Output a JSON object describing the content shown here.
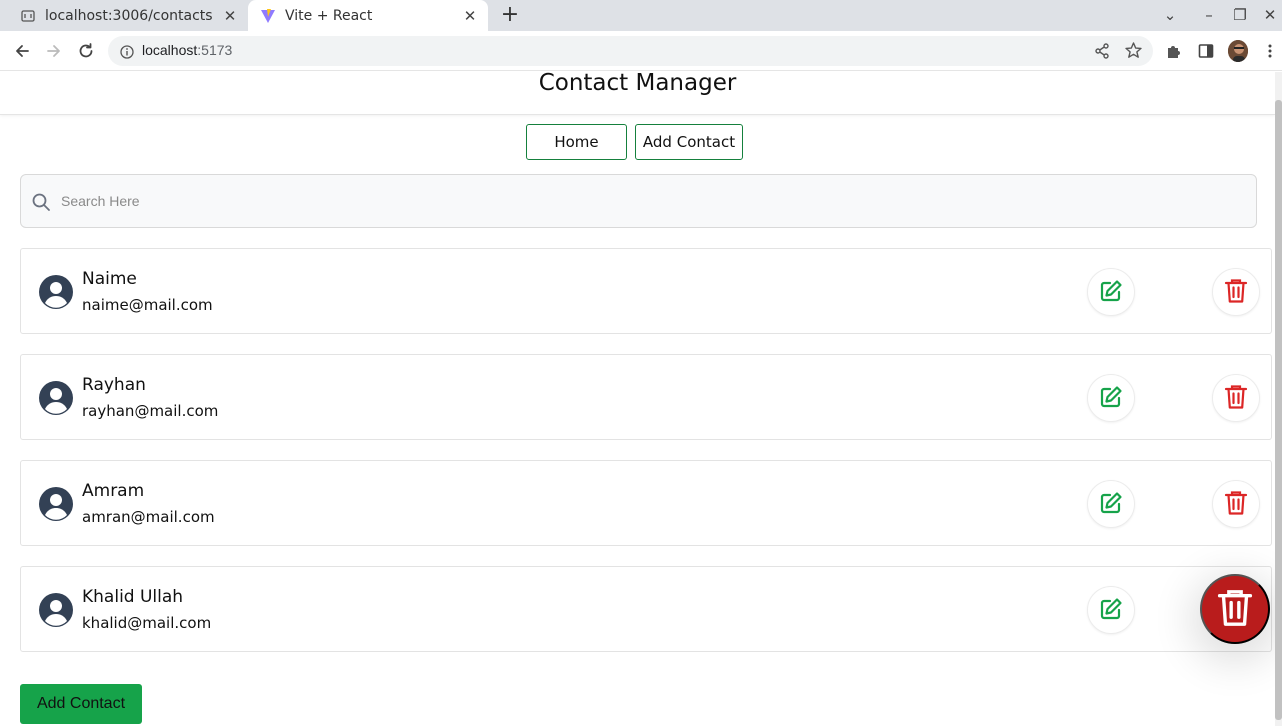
{
  "browser": {
    "tabs": [
      {
        "title": "localhost:3006/contacts",
        "active": false
      },
      {
        "title": "Vite + React",
        "active": true
      }
    ],
    "address": {
      "host": "localhost",
      "port": ":5173"
    }
  },
  "app": {
    "title": "Contact Manager",
    "nav": {
      "home_label": "Home",
      "add_contact_label": "Add Contact"
    },
    "search": {
      "placeholder": "Search Here",
      "value": ""
    },
    "contacts": [
      {
        "name": "Naime",
        "email": "naime@mail.com"
      },
      {
        "name": "Rayhan",
        "email": "rayhan@mail.com"
      },
      {
        "name": "Amram",
        "email": "amran@mail.com"
      },
      {
        "name": "Khalid Ullah",
        "email": "khalid@mail.com"
      }
    ],
    "add_button_label": "Add Contact"
  },
  "colors": {
    "accent_green": "#16a34a",
    "edit_icon": "#16a34a",
    "delete_icon": "#dc2626",
    "fab_bg": "#b91c1c",
    "avatar_icon": "#334155"
  },
  "icons": {
    "contact": "user-circle-icon",
    "edit": "pencil-square-icon",
    "delete": "trash-icon",
    "search": "search-icon"
  }
}
